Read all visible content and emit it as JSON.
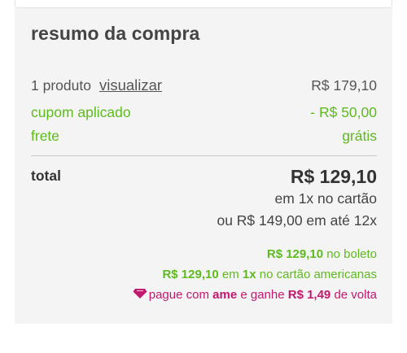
{
  "summary": {
    "title": "resumo da compra",
    "products_label": "1 produto",
    "view_link": "visualizar",
    "products_value": "R$ 179,10",
    "coupon_label": "cupom aplicado",
    "coupon_value": "- R$ 50,00",
    "shipping_label": "frete",
    "shipping_value": "grátis",
    "total_label": "total",
    "total_value": "R$ 129,10",
    "total_card_note": "em 1x no cartão",
    "installments_note": "ou R$ 149,00 em até 12x"
  },
  "offers": {
    "boleto_value": "R$ 129,10",
    "boleto_text": " no boleto",
    "card_value": "R$ 129,10",
    "card_mid": " em ",
    "card_times": "1x",
    "card_text": " no cartão americanas",
    "ame_prefix": "pague com ",
    "ame_brand": "ame",
    "ame_mid": " e ganhe ",
    "ame_value": "R$ 1,49",
    "ame_suffix": " de volta"
  },
  "colors": {
    "green": "#5fba1f",
    "pink": "#c2186d",
    "panel": "#f4f4f4"
  },
  "icons": {
    "ame": "ame-heart-icon"
  }
}
